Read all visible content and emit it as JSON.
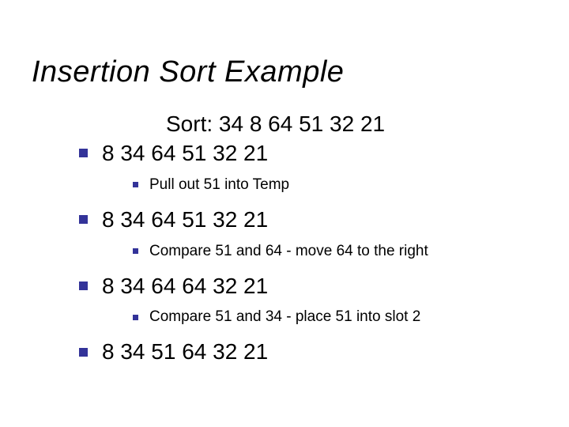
{
  "title": "Insertion Sort Example",
  "sort_label": "Sort: 34   8   64   51   32   21",
  "steps": [
    {
      "sequence": "8   34  64   51   32   21",
      "note": "Pull out 51 into Temp"
    },
    {
      "sequence": "8   34  64   51   32   21",
      "note": "Compare 51 and 64 - move 64 to the right"
    },
    {
      "sequence": "8   34  64   64   32   21",
      "note": "Compare 51 and 34 - place 51 into slot 2"
    },
    {
      "sequence": "8   34  51   64   32   21",
      "note": null
    }
  ]
}
